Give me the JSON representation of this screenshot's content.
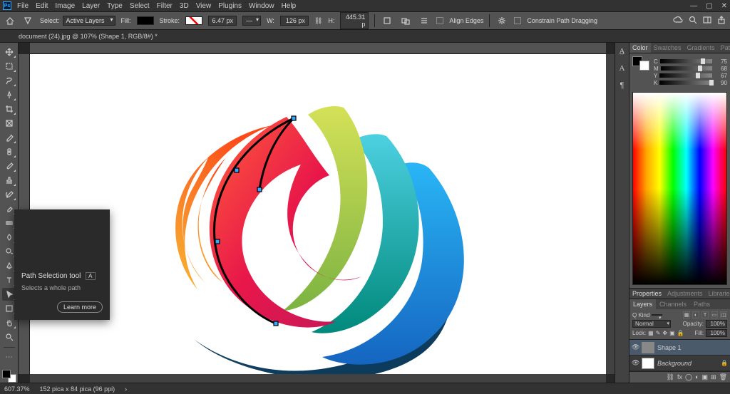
{
  "app": {
    "logo": "Ps"
  },
  "menu": [
    "File",
    "Edit",
    "Image",
    "Layer",
    "Type",
    "Select",
    "Filter",
    "3D",
    "View",
    "Plugins",
    "Window",
    "Help"
  ],
  "window_buttons": [
    "min",
    "max",
    "close"
  ],
  "optbar": {
    "select_label": "Select:",
    "select_value": "Active Layers",
    "fill_label": "Fill:",
    "stroke_label": "Stroke:",
    "stroke_value": "6.47 px",
    "w_label": "W:",
    "w_value": "126 px",
    "h_label": "H:",
    "h_value": "445.31 p",
    "align_edges": "Align Edges",
    "constrain": "Constrain Path Dragging"
  },
  "doctab": "document (24).jpg @ 107% (Shape 1, RGB/8#) *",
  "color_panel": {
    "tabs": [
      "Color",
      "Swatches",
      "Gradients",
      "Patterns"
    ],
    "sliders": [
      {
        "label": "C",
        "pos": 78,
        "val": "75"
      },
      {
        "label": "M",
        "pos": 72,
        "val": "68"
      },
      {
        "label": "Y",
        "pos": 69,
        "val": "67"
      },
      {
        "label": "K",
        "pos": 95,
        "val": "90"
      }
    ]
  },
  "props_tabs": [
    "Properties",
    "Adjustments",
    "Libraries"
  ],
  "layers_panel": {
    "tabs": [
      "Layers",
      "Channels",
      "Paths"
    ],
    "kind_label": "Q Kind",
    "blend_value": "Normal",
    "opacity_label": "Opacity:",
    "opacity_value": "100%",
    "lock_label": "Lock:",
    "fill_label": "Fill:",
    "fill_value": "100%",
    "layers": [
      {
        "name": "Shape 1",
        "selected": true,
        "locked": false
      },
      {
        "name": "Background",
        "selected": false,
        "locked": true
      }
    ]
  },
  "tooltip": {
    "title": "Path Selection tool",
    "key": "A",
    "desc": "Selects a whole path",
    "learn": "Learn more"
  },
  "status": {
    "zoom": "607.37%",
    "docinfo": "152 pica x 84 pica (96 ppi)"
  }
}
